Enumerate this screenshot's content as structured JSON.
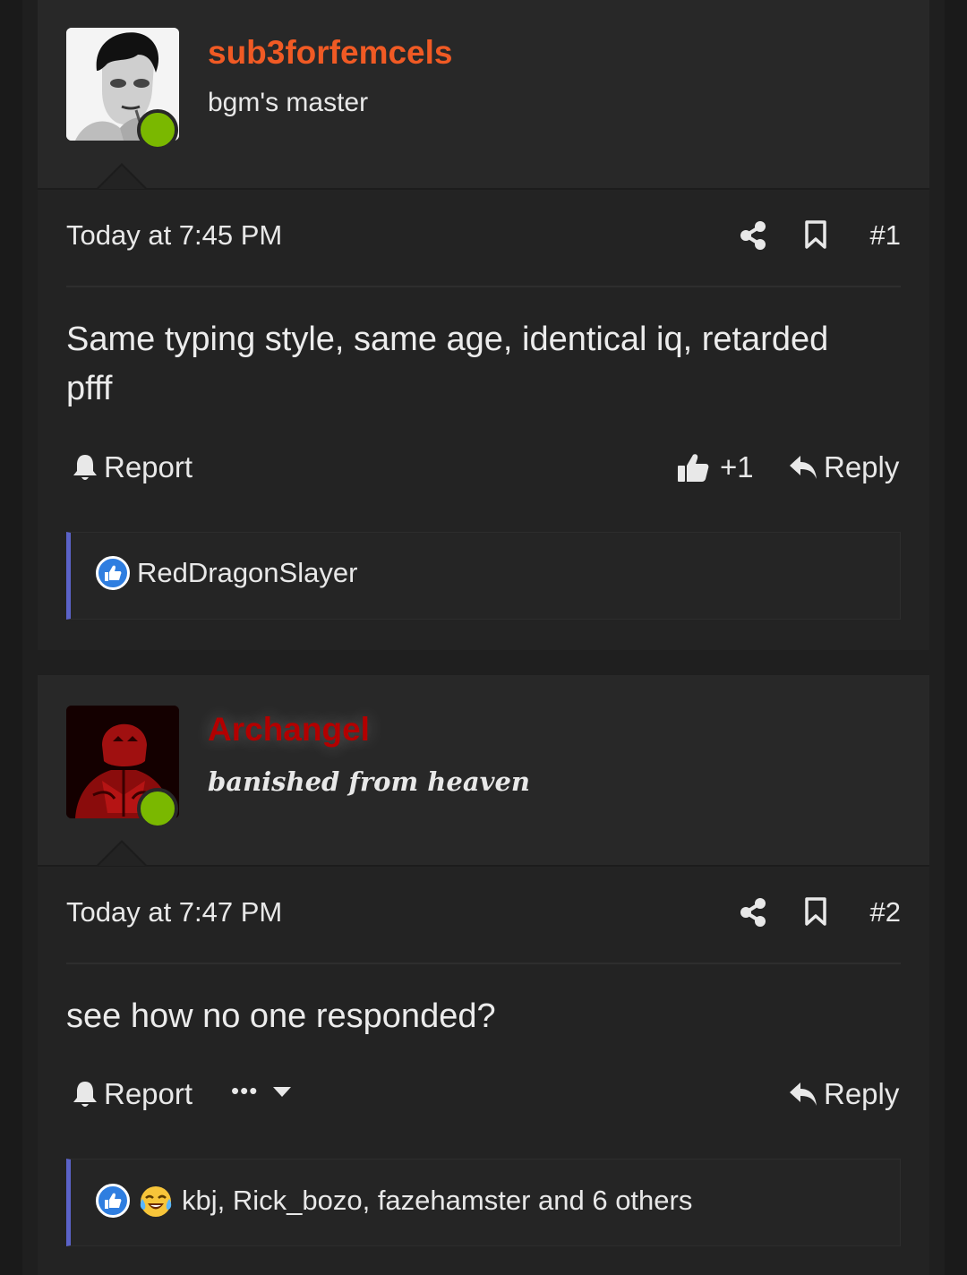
{
  "posts": [
    {
      "username": "sub3forfemcels",
      "username_color": "#f05a24",
      "user_title": "bgm's master",
      "date": "Today at 7:45 PM",
      "post_number": "#1",
      "body": "Same typing style, same age, identical iq, retarded pfff",
      "report_label": "Report",
      "like_count": "+1",
      "reply_label": "Reply",
      "reactions_text": "RedDragonSlayer"
    },
    {
      "username": "Archangel",
      "username_color": "#b30000",
      "user_title": "banished from heaven",
      "date": "Today at 7:47 PM",
      "post_number": "#2",
      "body": "see how no one responded?",
      "report_label": "Report",
      "more_label": "•••",
      "reply_label": "Reply",
      "reactions_text": "kbj, Rick_bozo, fazehamster and 6 others"
    }
  ],
  "colors": {
    "online": "#7ab800",
    "reaction_bar": "#5b63c8",
    "like_blue": "#2f7ee0"
  }
}
